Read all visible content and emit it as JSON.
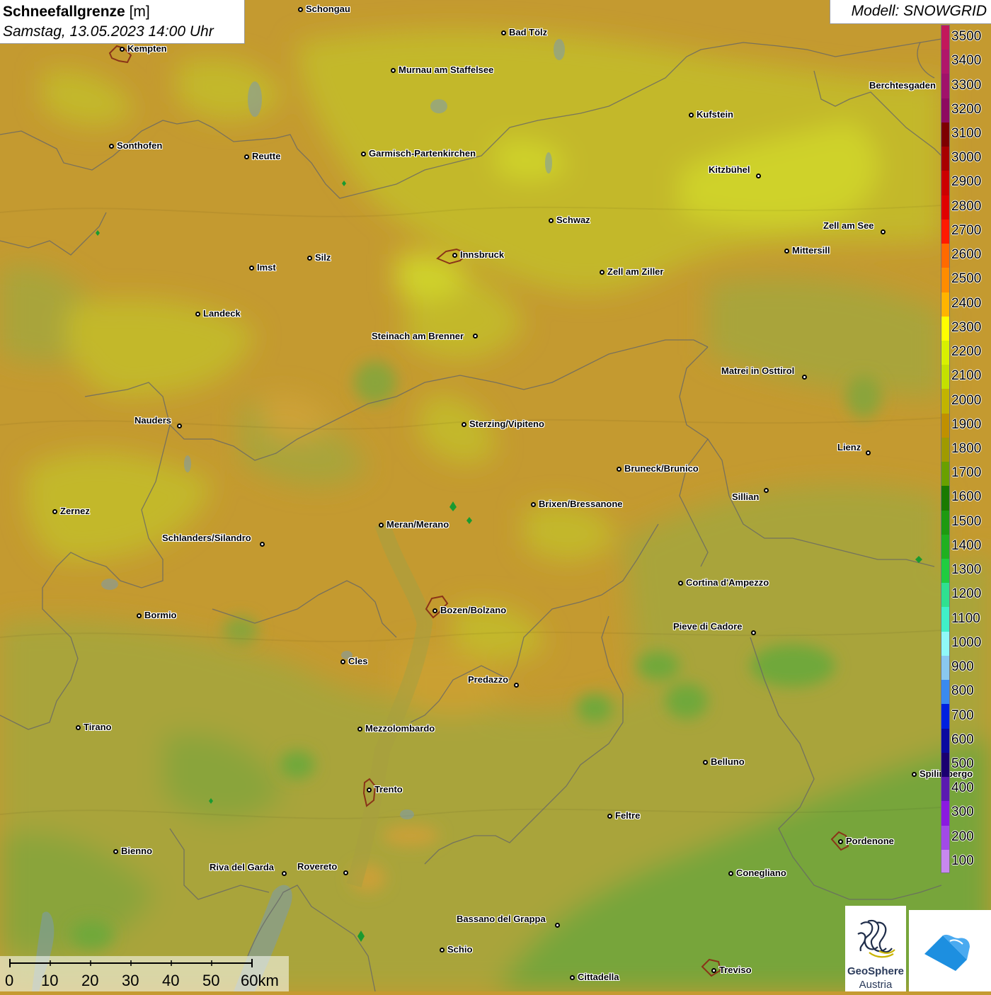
{
  "header": {
    "title_bold": "Schneefallgrenze",
    "title_unit": "[m]",
    "datetime": "Samstag, 13.05.2023 14:00 Uhr"
  },
  "model_label": "Modell: SNOWGRID",
  "legend": {
    "labels": [
      "3500",
      "3400",
      "3300",
      "3200",
      "3100",
      "3000",
      "2900",
      "2800",
      "2700",
      "2600",
      "2500",
      "2400",
      "2300",
      "2200",
      "2100",
      "2000",
      "1900",
      "1800",
      "1700",
      "1600",
      "1500",
      "1400",
      "1300",
      "1200",
      "1100",
      "1000",
      "900",
      "800",
      "700",
      "600",
      "500",
      "400",
      "300",
      "200",
      "100"
    ],
    "colors": [
      "#c2185b",
      "#b0166a",
      "#a0126a",
      "#8e0b60",
      "#7d0000",
      "#a80000",
      "#cc0000",
      "#e00000",
      "#ff1a00",
      "#ff6a00",
      "#ff8c00",
      "#ffb400",
      "#ffff00",
      "#d8f000",
      "#c4e000",
      "#c2b400",
      "#c09000",
      "#a09a00",
      "#6aa000",
      "#1a7a00",
      "#1e9a10",
      "#20b020",
      "#20cc40",
      "#30e090",
      "#40f0c8",
      "#90f8f8",
      "#8ac8f0",
      "#3a8af0",
      "#0020e0",
      "#0a0aa0",
      "#1a0070",
      "#5a1ab0",
      "#8a1ae0",
      "#a24ae8",
      "#c888f0"
    ]
  },
  "scalebar": {
    "labels": [
      "0",
      "10",
      "20",
      "30",
      "40",
      "50",
      "60km"
    ]
  },
  "logos": {
    "geosphere_line1": "GeoSphere",
    "geosphere_line2": "Austria",
    "logo1_icon": "geosphere-logo-icon",
    "logo2_icon": "mountain-cloud-logo-icon"
  },
  "cities": [
    {
      "name": "Schongau",
      "label_side": "right"
    },
    {
      "name": "Bad Tölz",
      "label_side": "right"
    },
    {
      "name": "Kempten",
      "label_side": "right"
    },
    {
      "name": "Murnau am Staffelsee",
      "label_side": "right"
    },
    {
      "name": "Berchtesgaden",
      "label_side": "left"
    },
    {
      "name": "Kufstein",
      "label_side": "right"
    },
    {
      "name": "Sonthofen",
      "label_side": "right"
    },
    {
      "name": "Reutte",
      "label_side": "right"
    },
    {
      "name": "Garmisch-Partenkirchen",
      "label_side": "right"
    },
    {
      "name": "Kitzbühel",
      "label_side": "left"
    },
    {
      "name": "Schwaz",
      "label_side": "right"
    },
    {
      "name": "Zell am See",
      "label_side": "left"
    },
    {
      "name": "Mittersill",
      "label_side": "right"
    },
    {
      "name": "Innsbruck",
      "label_side": "right"
    },
    {
      "name": "Silz",
      "label_side": "right"
    },
    {
      "name": "Imst",
      "label_side": "right"
    },
    {
      "name": "Zell am Ziller",
      "label_side": "right"
    },
    {
      "name": "Landeck",
      "label_side": "right"
    },
    {
      "name": "Steinach am Brenner",
      "label_side": "left"
    },
    {
      "name": "Matrei in Osttirol",
      "label_side": "left"
    },
    {
      "name": "Nauders",
      "label_side": "left"
    },
    {
      "name": "Sterzing/Vipiteno",
      "label_side": "right"
    },
    {
      "name": "Lienz",
      "label_side": "left"
    },
    {
      "name": "Bruneck/Brunico",
      "label_side": "right"
    },
    {
      "name": "Sillian",
      "label_side": "left"
    },
    {
      "name": "Brixen/Bressanone",
      "label_side": "right"
    },
    {
      "name": "Zernez",
      "label_side": "right"
    },
    {
      "name": "Meran/Merano",
      "label_side": "right"
    },
    {
      "name": "Schlanders/Silandro",
      "label_side": "left"
    },
    {
      "name": "Cortina d'Ampezzo",
      "label_side": "right"
    },
    {
      "name": "Bozen/Bolzano",
      "label_side": "right"
    },
    {
      "name": "Bormio",
      "label_side": "right"
    },
    {
      "name": "Pieve di Cadore",
      "label_side": "left"
    },
    {
      "name": "Cles",
      "label_side": "right"
    },
    {
      "name": "Predazzo",
      "label_side": "left"
    },
    {
      "name": "Tirano",
      "label_side": "right"
    },
    {
      "name": "Mezzolombardo",
      "label_side": "right"
    },
    {
      "name": "Belluno",
      "label_side": "right"
    },
    {
      "name": "Spilimbergo",
      "label_side": "right"
    },
    {
      "name": "Trento",
      "label_side": "right"
    },
    {
      "name": "Feltre",
      "label_side": "right"
    },
    {
      "name": "Pordenone",
      "label_side": "right"
    },
    {
      "name": "Bienno",
      "label_side": "right"
    },
    {
      "name": "Riva del Garda",
      "label_side": "left"
    },
    {
      "name": "Rovereto",
      "label_side": "left"
    },
    {
      "name": "Conegliano",
      "label_side": "right"
    },
    {
      "name": "Bassano del Grappa",
      "label_side": "left"
    },
    {
      "name": "Schio",
      "label_side": "right"
    },
    {
      "name": "Treviso",
      "label_side": "right"
    },
    {
      "name": "Cittadella",
      "label_side": "right"
    }
  ]
}
